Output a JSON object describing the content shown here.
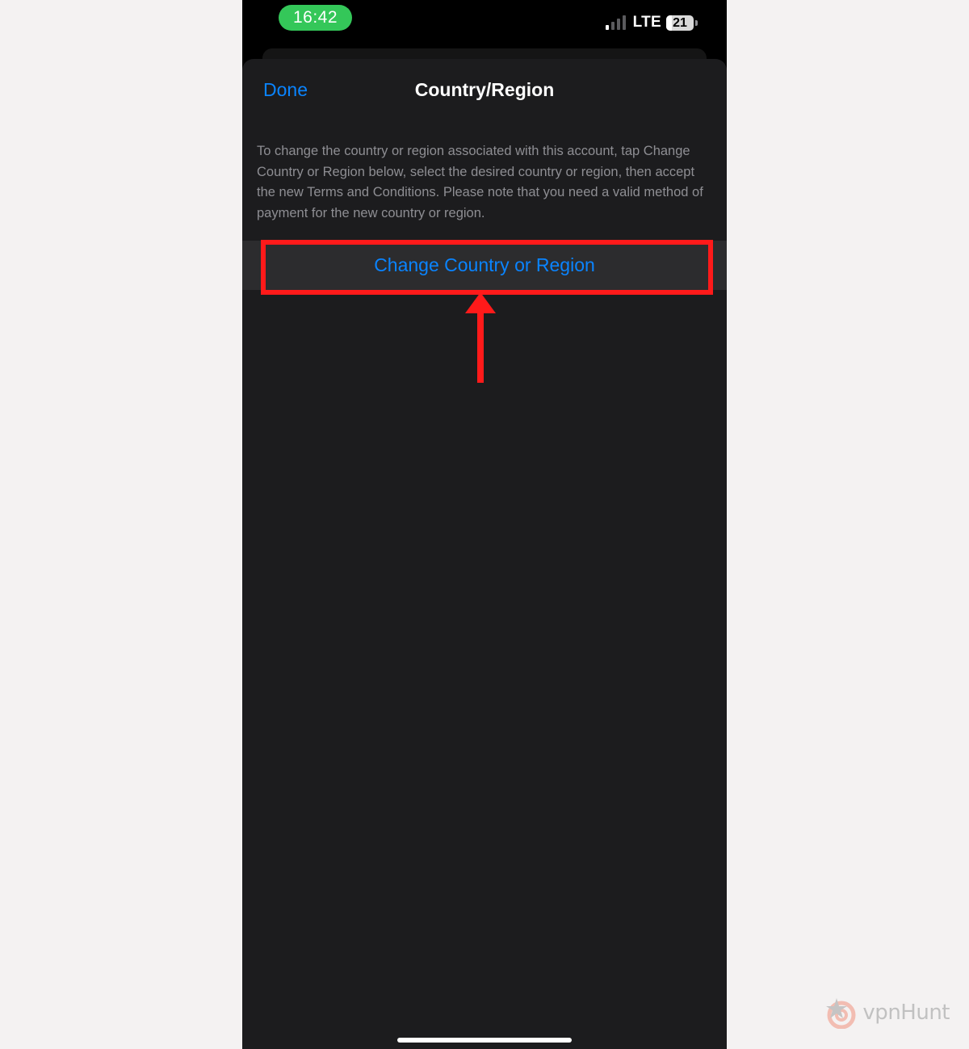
{
  "status_bar": {
    "time": "16:42",
    "network": "LTE",
    "battery": "21",
    "battery_level_percent": 21,
    "signal_bars_active": 1,
    "signal_bars_total": 4
  },
  "nav": {
    "done_label": "Done",
    "title": "Country/Region"
  },
  "body": {
    "description": "To change the country or region associated with this account, tap Change Country or Region below, select the desired country or region, then accept the new Terms and Conditions. Please note that you need a valid method of payment for the new country or region.",
    "change_button_label": "Change Country or Region"
  },
  "watermark": {
    "brand": "vpnHunt"
  },
  "colors": {
    "accent": "#0a84ff",
    "time_pill": "#34c759",
    "annotation": "#ff1a1a",
    "sheet_background": "#1c1c1e"
  },
  "icons": [
    "cellular-signal-icon",
    "battery-icon",
    "annotation-arrow-icon",
    "vpnhunt-logo-icon"
  ]
}
